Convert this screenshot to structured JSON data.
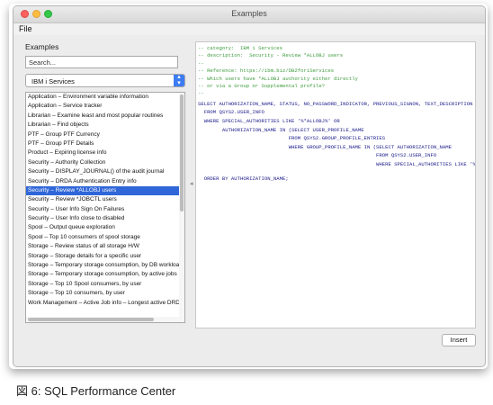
{
  "window": {
    "title": "Examples"
  },
  "menu": {
    "file": "File"
  },
  "left_panel": {
    "label": "Examples",
    "search_placeholder": "Search...",
    "category": "IBM i Services",
    "items": [
      "Application – Environment variable information",
      "Application – Service tracker",
      "Librarian – Examine least and most popular routines",
      "Librarian – Find objects",
      "PTF – Group PTF Currency",
      "PTF – Group PTF Details",
      "Product – Expiring license info",
      "Security – Authority Collection",
      "Security – DISPLAY_JOURNAL() of the audit journal",
      "Security – DRDA Authentication Entry info",
      "Security – Review *ALLOBJ users",
      "Security – Review *JOBCTL users",
      "Security – User Info Sign On Failures",
      "Security – User Info close to disabled",
      "Spool – Output queue exploration",
      "Spool – Top 10 consumers of spool storage",
      "Storage – Review status of all storage H/W",
      "Storage – Storage details for a specific user",
      "Storage – Temporary storage consumption, by DB workload",
      "Storage – Temporary storage consumption, by active jobs",
      "Storage – Top 10 Spool consumers, by user",
      "Storage – Top 10 consumers, by user",
      "Work Management – Active Job info – Longest active DRDA conn"
    ],
    "selected_index": 10
  },
  "code": {
    "comment_lines": [
      "-- category:  IBM i Services",
      "-- description:  Security - Review *ALLOBJ users",
      "--",
      "-- Reference: https://ibm.biz/DB2foriServices",
      "-- Which users have *ALLOBJ authority either directly",
      "-- or via a Group or Supplemental profile?",
      "--"
    ],
    "sql_lines": [
      "SELECT AUTHORIZATION_NAME, STATUS, NO_PASSWORD_INDICATOR, PREVIOUS_SIGNON, TEXT_DESCRIPTION",
      "  FROM QSYS2.USER_INFO",
      "  WHERE SPECIAL_AUTHORITIES LIKE '%*ALLOBJ%' OR",
      "        AUTHORIZATION_NAME IN (SELECT USER_PROFILE_NAME",
      "                              FROM QSYS2.GROUP_PROFILE_ENTRIES",
      "                              WHERE GROUP_PROFILE_NAME IN (SELECT AUTHORIZATION_NAME",
      "                                                           FROM QSYS2.USER_INFO",
      "                                                           WHERE SPECIAL_AUTHORITIES LIKE '%*ALLOBJ%'))",
      "  ORDER BY AUTHORIZATION_NAME;"
    ]
  },
  "insert_label": "Insert",
  "caption": "図 6: SQL Performance Center",
  "colors": {
    "selection": "#2f66d8",
    "comment": "#3d9a3d",
    "sql": "#1a1a8a"
  }
}
